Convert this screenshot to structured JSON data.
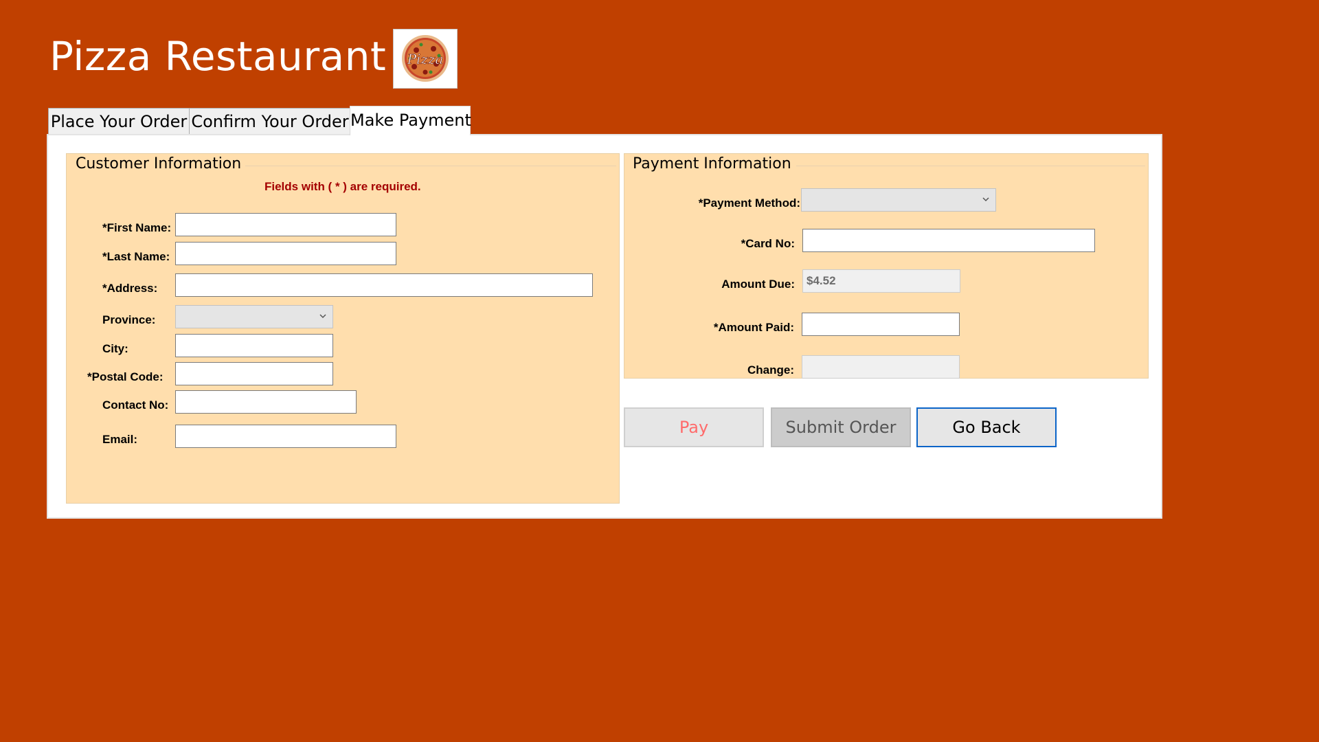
{
  "app": {
    "title": "Pizza Restaurant",
    "logo_icon": "pizza-logo",
    "logo_text": "Pizza"
  },
  "colors": {
    "background": "#c04000",
    "panel": "#ffffff",
    "group_fill": "#ffdead",
    "required_text": "#a40000",
    "pay_text": "#ff6b6b",
    "focus_border": "#0a64c8"
  },
  "tabs": [
    {
      "label": "Place Your Order",
      "active": false
    },
    {
      "label": "Confirm Your Order",
      "active": false
    },
    {
      "label": "Make Payment",
      "active": true
    }
  ],
  "customer": {
    "title": "Customer Information",
    "required_note": "Fields with ( * ) are required.",
    "first_name": {
      "label": "*First Name:",
      "value": ""
    },
    "last_name": {
      "label": "*Last Name:",
      "value": ""
    },
    "address": {
      "label": "*Address:",
      "value": ""
    },
    "province": {
      "label": "Province:",
      "value": ""
    },
    "city": {
      "label": "City:",
      "value": ""
    },
    "postal_code": {
      "label": "*Postal Code:",
      "value": ""
    },
    "contact_no": {
      "label": "Contact No:",
      "value": ""
    },
    "email": {
      "label": "Email:",
      "value": ""
    }
  },
  "payment": {
    "title": "Payment Information",
    "method": {
      "label": "*Payment Method:",
      "value": ""
    },
    "card_no": {
      "label": "*Card No:",
      "value": ""
    },
    "amount_due": {
      "label": "Amount Due:",
      "value": "$4.52"
    },
    "amount_paid": {
      "label": "*Amount Paid:",
      "value": ""
    },
    "change": {
      "label": "Change:",
      "value": ""
    }
  },
  "buttons": {
    "pay": "Pay",
    "submit": "Submit Order",
    "back": "Go Back"
  }
}
